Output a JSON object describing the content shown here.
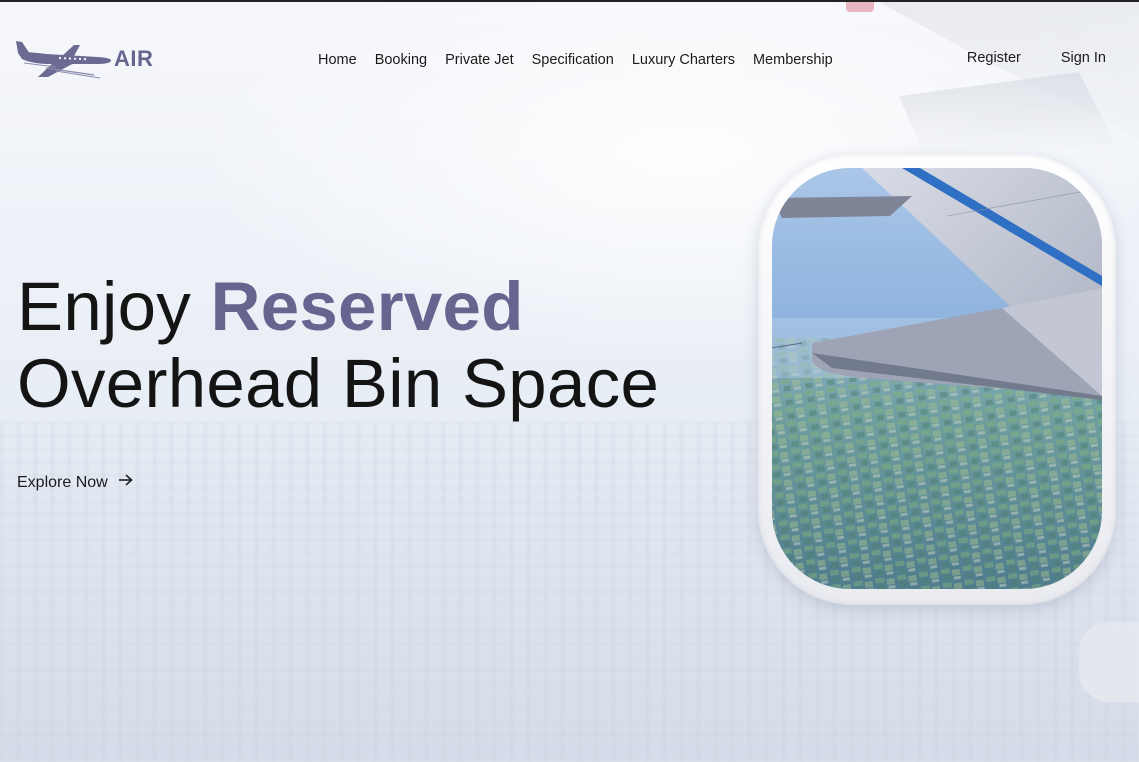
{
  "brand": {
    "name": "AIR",
    "logo_icon": "airplane-icon",
    "accent_color": "#66658f"
  },
  "nav": {
    "items": [
      {
        "label": "Home"
      },
      {
        "label": "Booking"
      },
      {
        "label": "Private Jet"
      },
      {
        "label": "Specification"
      },
      {
        "label": "Luxury Charters"
      },
      {
        "label": "Membership"
      }
    ]
  },
  "auth": {
    "register_label": "Register",
    "signin_label": "Sign In"
  },
  "hero": {
    "title_prefix": "Enjoy ",
    "title_accent": "Reserved",
    "title_line2": "Overhead Bin Space",
    "cta_label": "Explore Now",
    "cta_icon": "arrow-right-icon",
    "image_subject": "airplane-wing-window-view"
  }
}
